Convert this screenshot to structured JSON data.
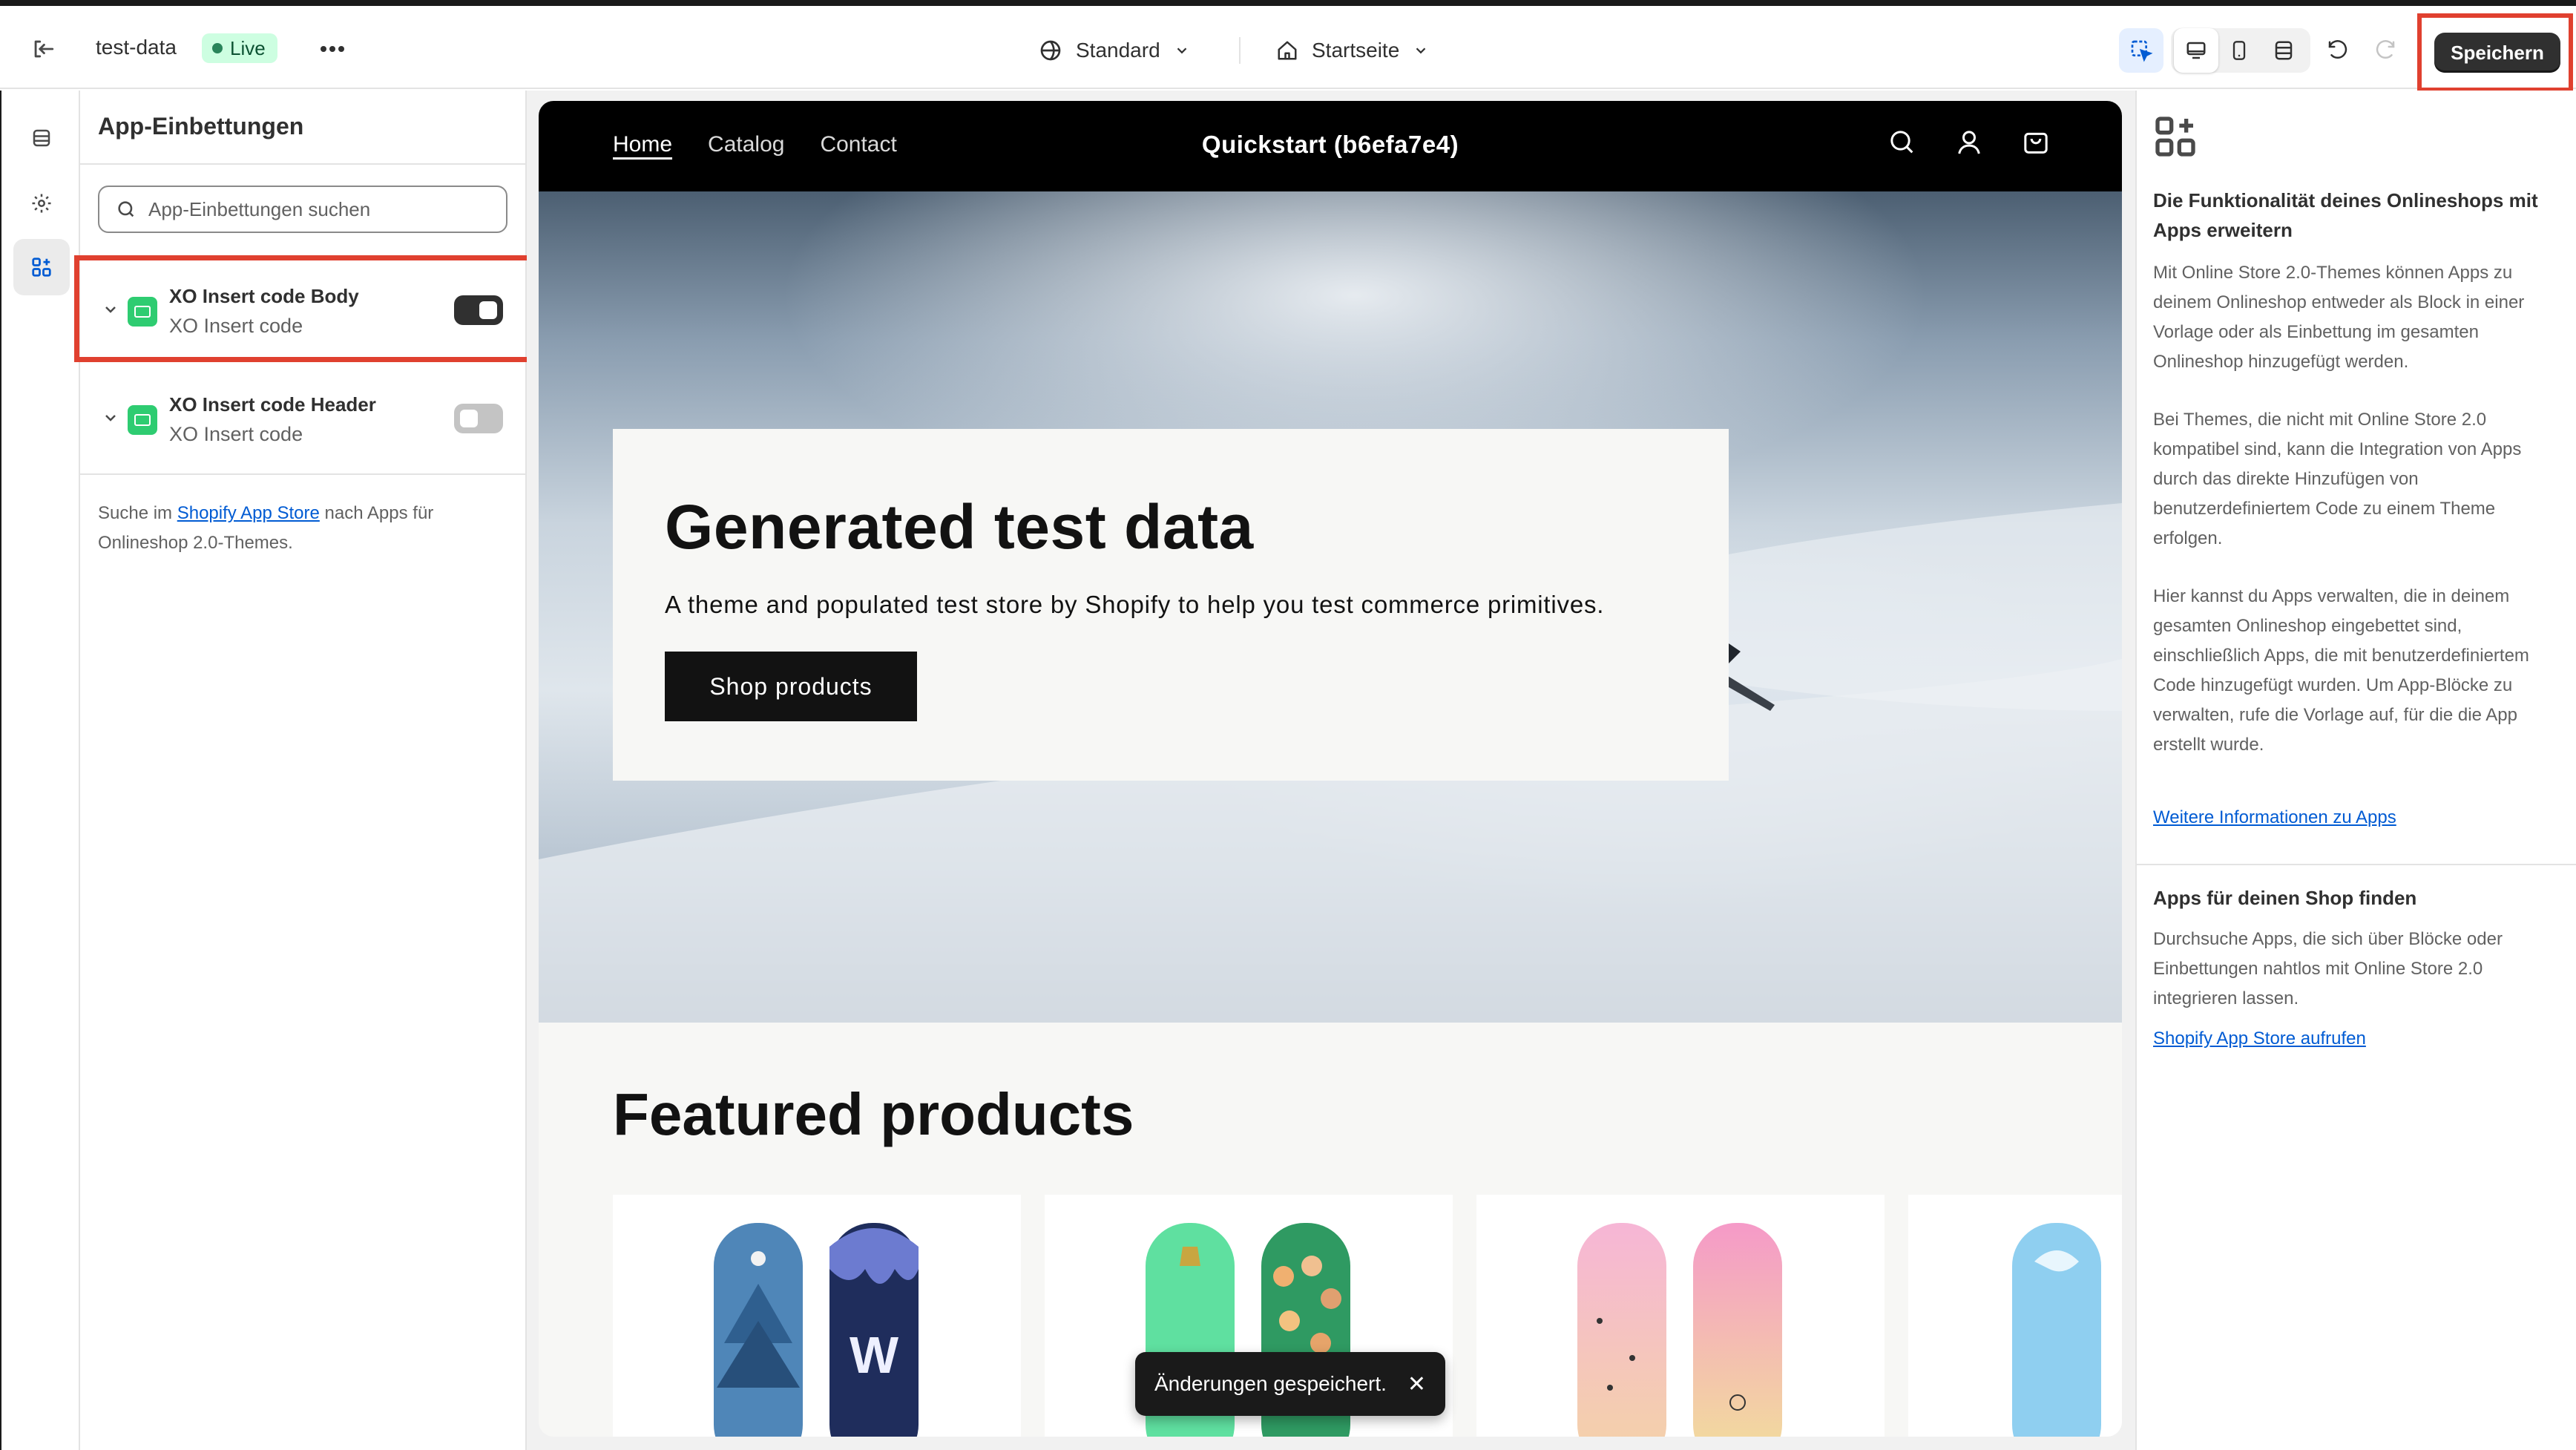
{
  "topbar": {
    "store_name": "test-data",
    "status_badge": "Live",
    "theme_select": "Standard",
    "page_select": "Startseite",
    "save_label": "Speichern"
  },
  "panel": {
    "title": "App-Einbettungen",
    "search_placeholder": "App-Einbettungen suchen",
    "embeds": [
      {
        "name": "XO Insert code Body",
        "app": "XO Insert code",
        "enabled": true
      },
      {
        "name": "XO Insert code Header",
        "app": "XO Insert code",
        "enabled": false
      }
    ],
    "footer_prefix": "Suche im ",
    "footer_link": "Shopify App Store",
    "footer_suffix": " nach Apps für Onlineshop 2.0-Themes."
  },
  "preview": {
    "nav": [
      "Home",
      "Catalog",
      "Contact"
    ],
    "brand": "Quickstart (b6efa7e4)",
    "hero_title": "Generated test data",
    "hero_text": "A theme and populated test store by Shopify to help you test commerce primitives.",
    "hero_button": "Shop products",
    "featured_title": "Featured products"
  },
  "toast": {
    "message": "Änderungen gespeichert."
  },
  "info": {
    "heading1": "Die Funktionalität deines Onlineshops mit Apps erweitern",
    "para1": "Mit Online Store 2.0-Themes können Apps zu deinem Onlineshop entweder als Block in einer Vorlage oder als Einbettung im gesamten Onlineshop hinzugefügt werden.",
    "para2": "Bei Themes, die nicht mit Online Store 2.0 kompatibel sind, kann die Integration von Apps durch das direkte Hinzufügen von benutzerdefiniertem Code zu einem Theme erfolgen.",
    "para3": "Hier kannst du Apps verwalten, die in deinem gesamten Onlineshop eingebettet sind, einschließlich Apps, die mit benutzerdefiniertem Code hinzugefügt wurden. Um App-Blöcke zu verwalten, rufe die Vorlage auf, für die die App erstellt wurde.",
    "link1": "Weitere Informationen zu Apps",
    "heading2": "Apps für deinen Shop finden",
    "para4": "Durchsuche Apps, die sich über Blöcke oder Einbettungen nahtlos mit Online Store 2.0 integrieren lassen.",
    "link2": "Shopify App Store aufrufen"
  },
  "colors": {
    "accent": "#005bd3",
    "highlight": "#e0402f",
    "live_badge_bg": "#cdfee1",
    "dark_button": "#303030"
  }
}
